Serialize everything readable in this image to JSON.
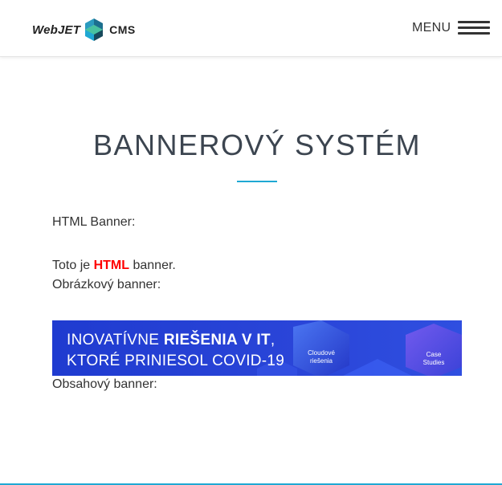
{
  "header": {
    "logo_word": "WebJET",
    "logo_cms": "CMS",
    "menu_label": "MENU"
  },
  "page": {
    "title": "BANNEROVÝ SYSTÉM",
    "html_banner_label": "HTML Banner:",
    "html_banner_text_prefix": "Toto je ",
    "html_banner_text_highlight": "HTML",
    "html_banner_text_suffix": " banner.",
    "image_banner_label": "Obrázkový banner:",
    "content_banner_label": "Obsahový banner:"
  },
  "banner": {
    "line1_regular": "INOVATÍVNE ",
    "line1_bold": "RIEŠENIA V IT",
    "line1_comma": ",",
    "line2": "KTORÉ PRINIESOL COVID-19",
    "hex1_label_a": "Cloudové",
    "hex1_label_b": "riešenia",
    "hex2_label_a": "Case",
    "hex2_label_b": "Studies"
  },
  "colors": {
    "accent": "#1fa8d3",
    "highlight": "#ff0000",
    "banner_bg": "#2a45d8"
  }
}
